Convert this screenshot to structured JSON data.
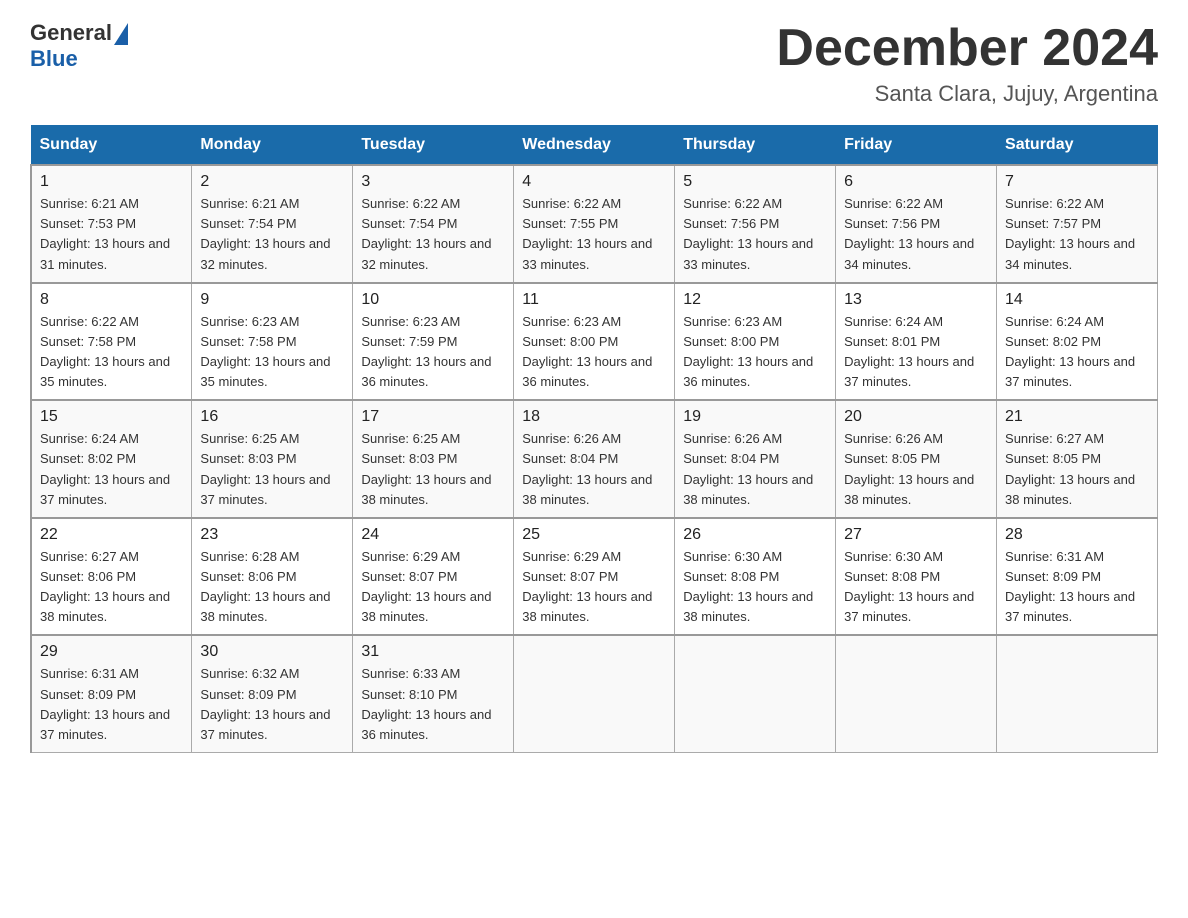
{
  "header": {
    "logo_general": "General",
    "logo_blue": "Blue",
    "month_title": "December 2024",
    "location": "Santa Clara, Jujuy, Argentina"
  },
  "weekdays": [
    "Sunday",
    "Monday",
    "Tuesday",
    "Wednesday",
    "Thursday",
    "Friday",
    "Saturday"
  ],
  "weeks": [
    [
      {
        "day": "1",
        "sunrise": "6:21 AM",
        "sunset": "7:53 PM",
        "daylight": "13 hours and 31 minutes."
      },
      {
        "day": "2",
        "sunrise": "6:21 AM",
        "sunset": "7:54 PM",
        "daylight": "13 hours and 32 minutes."
      },
      {
        "day": "3",
        "sunrise": "6:22 AM",
        "sunset": "7:54 PM",
        "daylight": "13 hours and 32 minutes."
      },
      {
        "day": "4",
        "sunrise": "6:22 AM",
        "sunset": "7:55 PM",
        "daylight": "13 hours and 33 minutes."
      },
      {
        "day": "5",
        "sunrise": "6:22 AM",
        "sunset": "7:56 PM",
        "daylight": "13 hours and 33 minutes."
      },
      {
        "day": "6",
        "sunrise": "6:22 AM",
        "sunset": "7:56 PM",
        "daylight": "13 hours and 34 minutes."
      },
      {
        "day": "7",
        "sunrise": "6:22 AM",
        "sunset": "7:57 PM",
        "daylight": "13 hours and 34 minutes."
      }
    ],
    [
      {
        "day": "8",
        "sunrise": "6:22 AM",
        "sunset": "7:58 PM",
        "daylight": "13 hours and 35 minutes."
      },
      {
        "day": "9",
        "sunrise": "6:23 AM",
        "sunset": "7:58 PM",
        "daylight": "13 hours and 35 minutes."
      },
      {
        "day": "10",
        "sunrise": "6:23 AM",
        "sunset": "7:59 PM",
        "daylight": "13 hours and 36 minutes."
      },
      {
        "day": "11",
        "sunrise": "6:23 AM",
        "sunset": "8:00 PM",
        "daylight": "13 hours and 36 minutes."
      },
      {
        "day": "12",
        "sunrise": "6:23 AM",
        "sunset": "8:00 PM",
        "daylight": "13 hours and 36 minutes."
      },
      {
        "day": "13",
        "sunrise": "6:24 AM",
        "sunset": "8:01 PM",
        "daylight": "13 hours and 37 minutes."
      },
      {
        "day": "14",
        "sunrise": "6:24 AM",
        "sunset": "8:02 PM",
        "daylight": "13 hours and 37 minutes."
      }
    ],
    [
      {
        "day": "15",
        "sunrise": "6:24 AM",
        "sunset": "8:02 PM",
        "daylight": "13 hours and 37 minutes."
      },
      {
        "day": "16",
        "sunrise": "6:25 AM",
        "sunset": "8:03 PM",
        "daylight": "13 hours and 37 minutes."
      },
      {
        "day": "17",
        "sunrise": "6:25 AM",
        "sunset": "8:03 PM",
        "daylight": "13 hours and 38 minutes."
      },
      {
        "day": "18",
        "sunrise": "6:26 AM",
        "sunset": "8:04 PM",
        "daylight": "13 hours and 38 minutes."
      },
      {
        "day": "19",
        "sunrise": "6:26 AM",
        "sunset": "8:04 PM",
        "daylight": "13 hours and 38 minutes."
      },
      {
        "day": "20",
        "sunrise": "6:26 AM",
        "sunset": "8:05 PM",
        "daylight": "13 hours and 38 minutes."
      },
      {
        "day": "21",
        "sunrise": "6:27 AM",
        "sunset": "8:05 PM",
        "daylight": "13 hours and 38 minutes."
      }
    ],
    [
      {
        "day": "22",
        "sunrise": "6:27 AM",
        "sunset": "8:06 PM",
        "daylight": "13 hours and 38 minutes."
      },
      {
        "day": "23",
        "sunrise": "6:28 AM",
        "sunset": "8:06 PM",
        "daylight": "13 hours and 38 minutes."
      },
      {
        "day": "24",
        "sunrise": "6:29 AM",
        "sunset": "8:07 PM",
        "daylight": "13 hours and 38 minutes."
      },
      {
        "day": "25",
        "sunrise": "6:29 AM",
        "sunset": "8:07 PM",
        "daylight": "13 hours and 38 minutes."
      },
      {
        "day": "26",
        "sunrise": "6:30 AM",
        "sunset": "8:08 PM",
        "daylight": "13 hours and 38 minutes."
      },
      {
        "day": "27",
        "sunrise": "6:30 AM",
        "sunset": "8:08 PM",
        "daylight": "13 hours and 37 minutes."
      },
      {
        "day": "28",
        "sunrise": "6:31 AM",
        "sunset": "8:09 PM",
        "daylight": "13 hours and 37 minutes."
      }
    ],
    [
      {
        "day": "29",
        "sunrise": "6:31 AM",
        "sunset": "8:09 PM",
        "daylight": "13 hours and 37 minutes."
      },
      {
        "day": "30",
        "sunrise": "6:32 AM",
        "sunset": "8:09 PM",
        "daylight": "13 hours and 37 minutes."
      },
      {
        "day": "31",
        "sunrise": "6:33 AM",
        "sunset": "8:10 PM",
        "daylight": "13 hours and 36 minutes."
      },
      null,
      null,
      null,
      null
    ]
  ]
}
